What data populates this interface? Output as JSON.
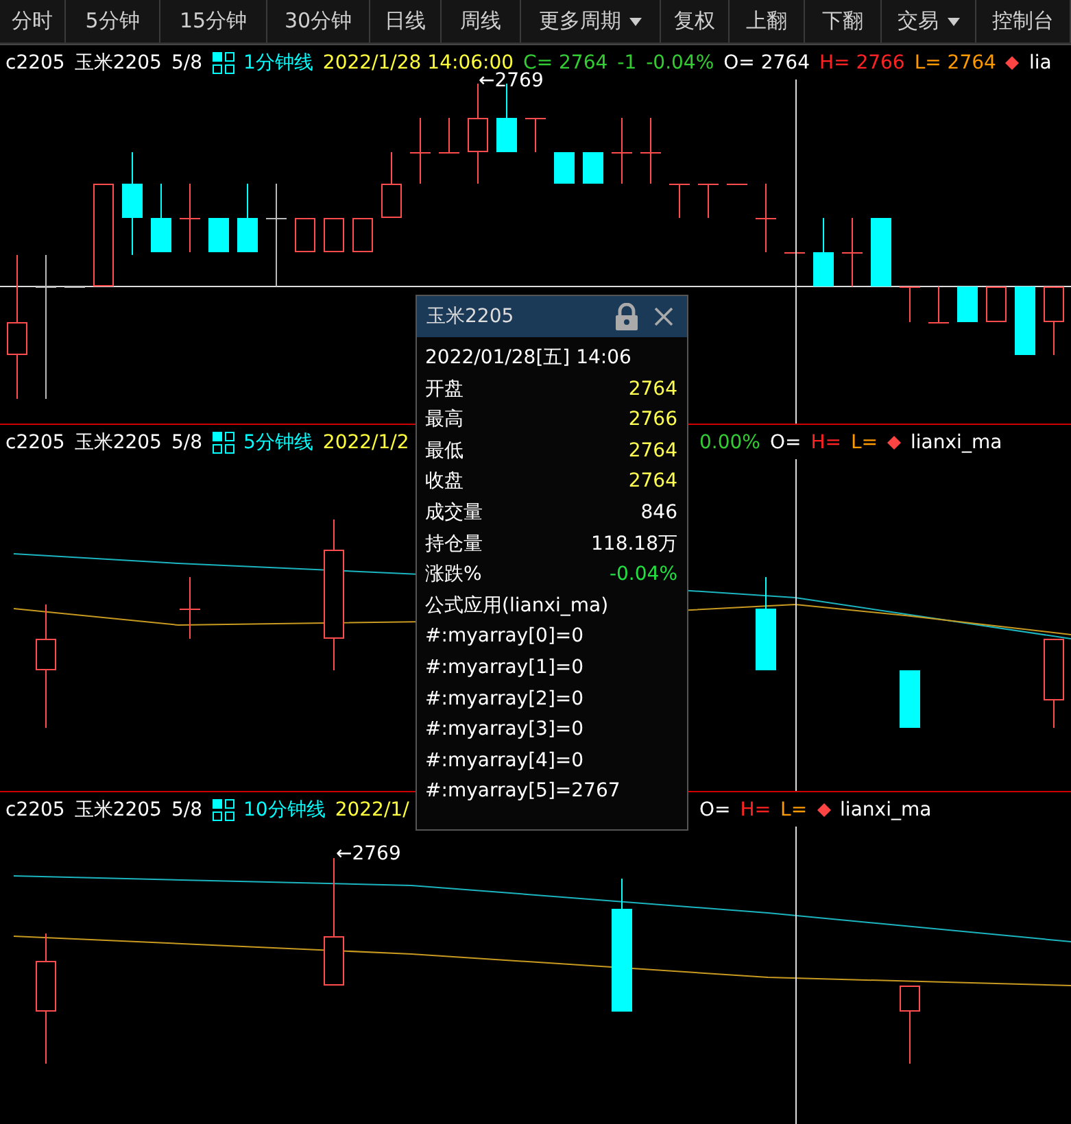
{
  "toolbar": {
    "buttons": [
      {
        "label": "分时",
        "kind": "plain"
      },
      {
        "label": "5分钟",
        "kind": "plain"
      },
      {
        "label": "15分钟",
        "kind": "plain"
      },
      {
        "label": "30分钟",
        "kind": "plain"
      },
      {
        "label": "日线",
        "kind": "plain"
      },
      {
        "label": "周线",
        "kind": "plain"
      },
      {
        "label": "更多周期",
        "kind": "dropdown"
      },
      {
        "label": "复权",
        "kind": "plain"
      },
      {
        "label": "上翻",
        "kind": "plain"
      },
      {
        "label": "下翻",
        "kind": "plain"
      },
      {
        "label": "交易",
        "kind": "dropdown"
      },
      {
        "label": "控制台",
        "kind": "plain"
      }
    ]
  },
  "panels": [
    {
      "symbol": "c2205",
      "name": "玉米2205",
      "count": "5/8",
      "period": "1分钟线",
      "time": "2022/1/28 14:06:00",
      "close": "C= 2764",
      "change": "-1",
      "change_pct": "-0.04%",
      "open": "O= 2764",
      "high": "H= 2766",
      "low": "L= 2764",
      "indicator": "lia",
      "marker": "←2769"
    },
    {
      "symbol": "c2205",
      "name": "玉米2205",
      "count": "5/8",
      "period": "5分钟线",
      "time": "2022/1/2",
      "change_pct": "0.00%",
      "open": "O=",
      "high": "H=",
      "low": "L=",
      "indicator": "lianxi_ma"
    },
    {
      "symbol": "c2205",
      "name": "玉米2205",
      "count": "5/8",
      "period": "10分钟线",
      "time": "2022/1/",
      "open": "O=",
      "high": "H=",
      "low": "L=",
      "indicator": "lianxi_ma",
      "marker": "←2769"
    }
  ],
  "popup": {
    "title": "玉米2205",
    "datetime": "2022/01/28[五] 14:06",
    "rows": [
      {
        "label": "开盘",
        "value": "2764",
        "kind": "price"
      },
      {
        "label": "最高",
        "value": "2766",
        "kind": "price"
      },
      {
        "label": "最低",
        "value": "2764",
        "kind": "price"
      },
      {
        "label": "收盘",
        "value": "2764",
        "kind": "price"
      },
      {
        "label": "成交量",
        "value": "846",
        "kind": "volume"
      },
      {
        "label": "持仓量",
        "value": "118.18万",
        "kind": "volume"
      },
      {
        "label": "涨跌%",
        "value": "-0.04%",
        "kind": "change"
      }
    ],
    "formula": "公式应用(lianxi_ma)",
    "lines": [
      "#:myarray[0]=0",
      "#:myarray[1]=0",
      "#:myarray[2]=0",
      "#:myarray[3]=0",
      "#:myarray[4]=0",
      "#:myarray[5]=2767"
    ]
  }
}
